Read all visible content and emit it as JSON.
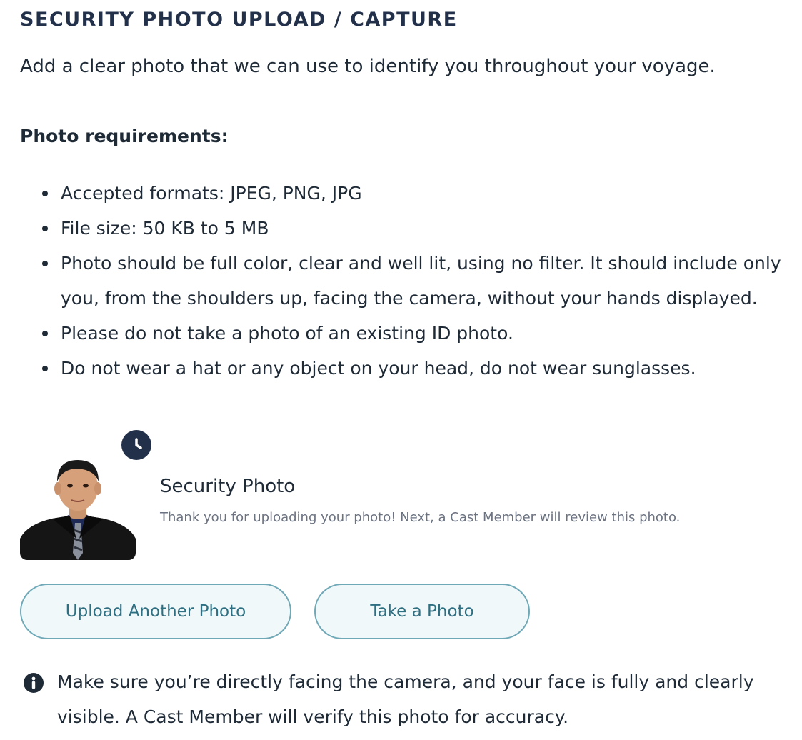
{
  "section": {
    "title": "SECURITY PHOTO UPLOAD / CAPTURE",
    "intro": "Add a clear photo that we can use to identify you throughout your voyage."
  },
  "requirements": {
    "heading": "Photo requirements:",
    "items": [
      "Accepted formats: JPEG, PNG, JPG",
      "File size: 50 KB to 5 MB",
      "Photo should be full color, clear and well lit, using no filter. It should include only you, from the shoulders up, facing the camera, without your hands displayed.",
      "Please do not take a photo of an existing ID photo.",
      "Do not wear a hat or any object on your head, do not wear sunglasses."
    ]
  },
  "photo": {
    "title": "Security Photo",
    "status_message": "Thank you for uploading your photo! Next, a Cast Member will review this photo.",
    "status_icon": "clock-icon"
  },
  "buttons": {
    "upload_label": "Upload Another Photo",
    "take_label": "Take a Photo"
  },
  "notice": {
    "icon": "info-icon",
    "text": "Make sure you’re directly facing the camera, and your face is fully and clearly visible. A Cast Member will verify this photo for accuracy."
  },
  "colors": {
    "heading": "#22304a",
    "text": "#1f2a37",
    "muted": "#6b7280",
    "button_border": "#6fa8b6",
    "button_text": "#2e6f82",
    "button_bg": "#f1f8fa"
  }
}
